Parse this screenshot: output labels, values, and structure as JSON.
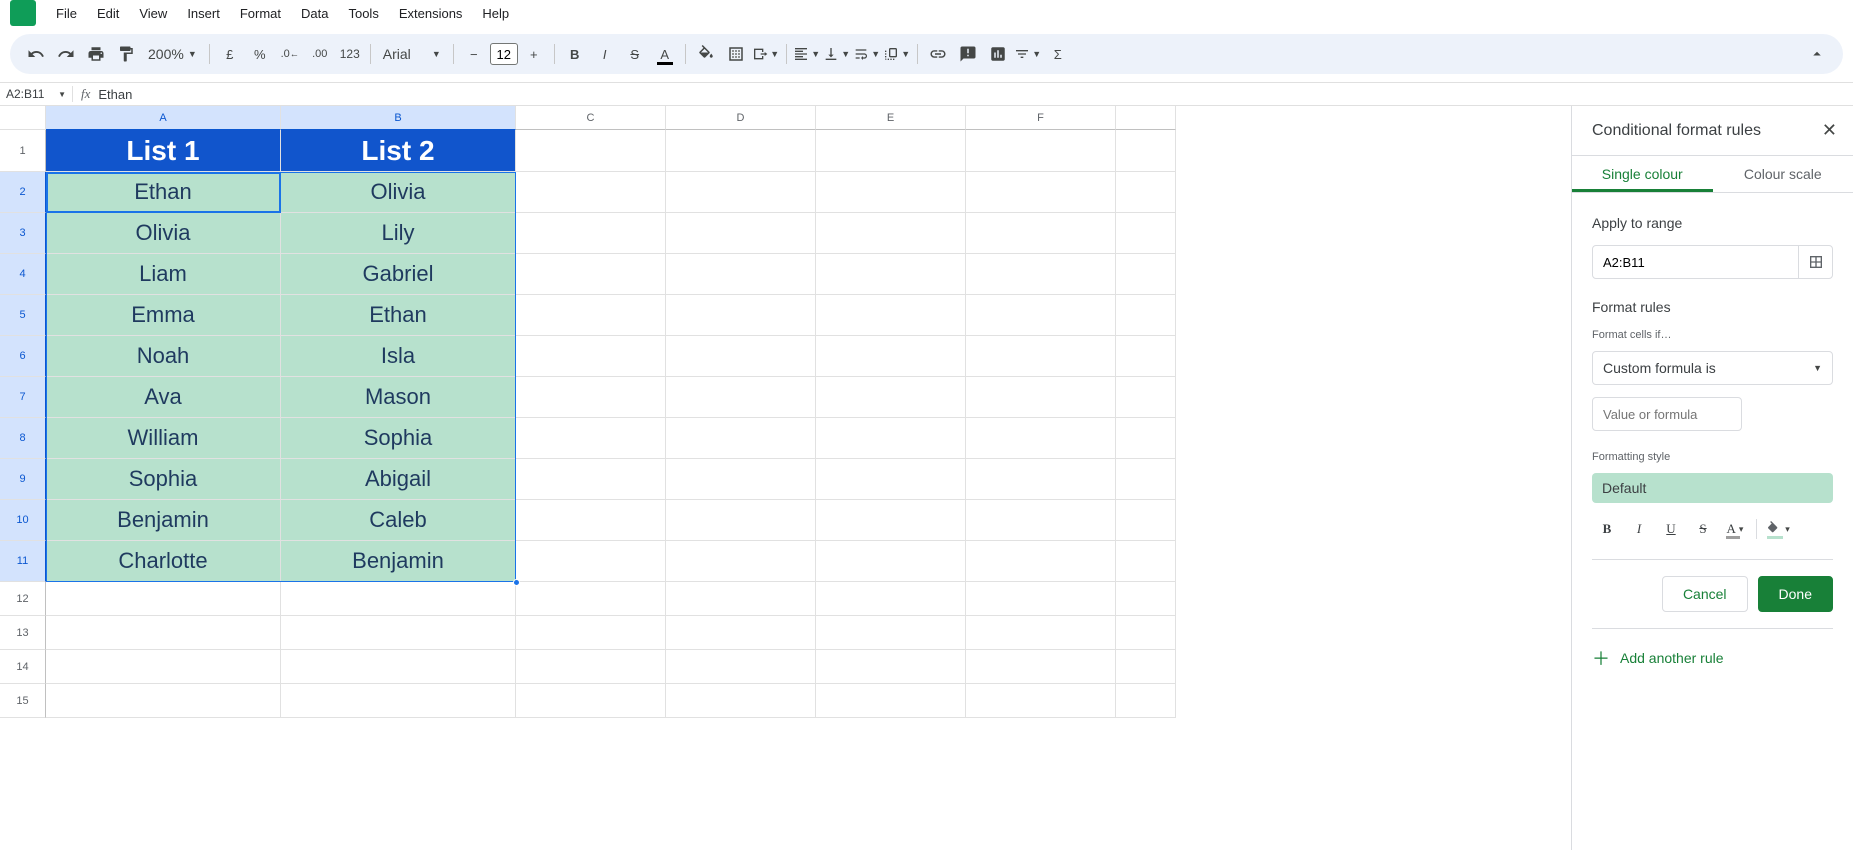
{
  "menu": {
    "file": "File",
    "edit": "Edit",
    "view": "View",
    "insert": "Insert",
    "format": "Format",
    "data": "Data",
    "tools": "Tools",
    "extensions": "Extensions",
    "help": "Help"
  },
  "toolbar": {
    "zoom": "200%",
    "font": "Arial",
    "font_size": "12"
  },
  "namebox": "A2:B11",
  "formula_value": "Ethan",
  "columns": {
    "A": "A",
    "B": "B",
    "C": "C",
    "D": "D",
    "E": "E",
    "F": "F"
  },
  "rows": [
    "1",
    "2",
    "3",
    "4",
    "5",
    "6",
    "7",
    "8",
    "9",
    "10",
    "11",
    "12",
    "13",
    "14",
    "15"
  ],
  "headers": {
    "a": "List 1",
    "b": "List 2"
  },
  "list1": [
    "Ethan",
    "Olivia",
    "Liam",
    "Emma",
    "Noah",
    "Ava",
    "William",
    "Sophia",
    "Benjamin",
    "Charlotte"
  ],
  "list2": [
    "Olivia",
    "Lily",
    "Gabriel",
    "Ethan",
    "Isla",
    "Mason",
    "Sophia",
    "Abigail",
    "Caleb",
    "Benjamin"
  ],
  "sidebar": {
    "title": "Conditional format rules",
    "tab_single": "Single colour",
    "tab_scale": "Colour scale",
    "apply_label": "Apply to range",
    "range_value": "A2:B11",
    "rules_label": "Format rules",
    "cells_if_label": "Format cells if…",
    "condition": "Custom formula is",
    "formula_placeholder": "Value or formula",
    "style_label": "Formatting style",
    "default_chip": "Default",
    "cancel": "Cancel",
    "done": "Done",
    "add_rule": "Add another rule"
  }
}
